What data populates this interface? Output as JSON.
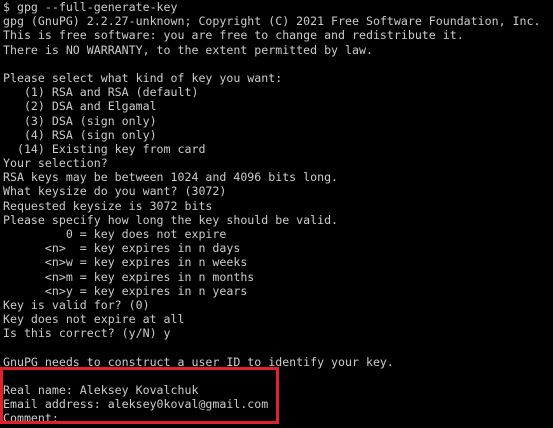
{
  "terminal": {
    "lines": [
      "$ gpg --full-generate-key",
      "gpg (GnuPG) 2.2.27-unknown; Copyright (C) 2021 Free Software Foundation, Inc.",
      "This is free software: you are free to change and redistribute it.",
      "There is NO WARRANTY, to the extent permitted by law.",
      "",
      "Please select what kind of key you want:",
      "   (1) RSA and RSA (default)",
      "   (2) DSA and Elgamal",
      "   (3) DSA (sign only)",
      "   (4) RSA (sign only)",
      "  (14) Existing key from card",
      "Your selection?",
      "RSA keys may be between 1024 and 4096 bits long.",
      "What keysize do you want? (3072)",
      "Requested keysize is 3072 bits",
      "Please specify how long the key should be valid.",
      "         0 = key does not expire",
      "      <n>  = key expires in n days",
      "      <n>w = key expires in n weeks",
      "      <n>m = key expires in n months",
      "      <n>y = key expires in n years",
      "Key is valid for? (0)",
      "Key does not expire at all",
      "Is this correct? (y/N) y",
      "",
      "GnuPG needs to construct a user ID to identify your key.",
      "",
      "Real name: Aleksey Kovalchuk",
      "Email address: aleksey0koval@gmail.com",
      "Comment: "
    ]
  },
  "colors": {
    "background": "#000000",
    "text": "#cccccc",
    "highlight_border": "#e0202a"
  }
}
